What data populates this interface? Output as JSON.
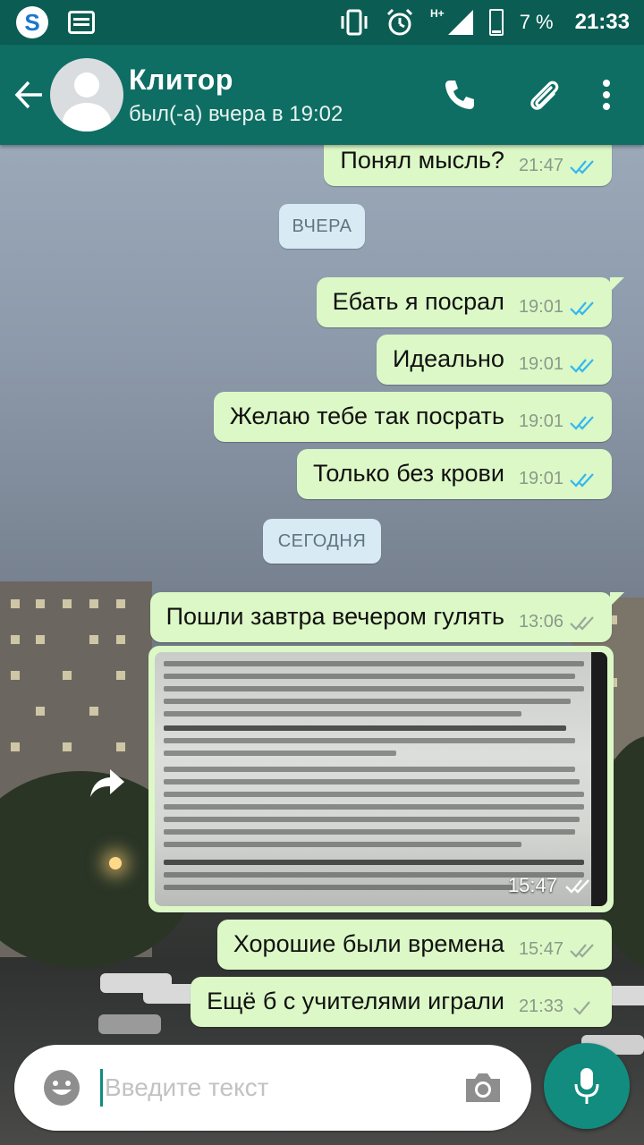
{
  "status_bar": {
    "network": "H+",
    "battery": "7 %",
    "time": "21:33"
  },
  "header": {
    "contact_name": "Клитор",
    "last_seen": "был(-а) вчера в 19:02"
  },
  "colors": {
    "header": "#0e6e63",
    "status_bar": "#0b5d53",
    "outgoing_bubble": "#dcf8c6",
    "read_ticks": "#34b7f1",
    "delivered_ticks": "#9aa99a",
    "mic_button": "#128c7e"
  },
  "chat": {
    "date_yesterday": "ВЧЕРА",
    "date_today": "СЕГОДНЯ",
    "messages": [
      {
        "text": "Понял мысль?",
        "time": "21:47",
        "status": "read"
      },
      {
        "text": "Ебать я посрал",
        "time": "19:01",
        "status": "read"
      },
      {
        "text": "Идеально",
        "time": "19:01",
        "status": "read"
      },
      {
        "text": "Желаю тебе так посрать",
        "time": "19:01",
        "status": "read"
      },
      {
        "text": "Только без крови",
        "time": "19:01",
        "status": "read"
      },
      {
        "text": "Пошли завтра вечером гулять",
        "time": "13:06",
        "status": "delivered"
      },
      {
        "text": "",
        "time": "15:47",
        "status": "delivered",
        "type": "image"
      },
      {
        "text": "Хорошие были времена",
        "time": "15:47",
        "status": "delivered"
      },
      {
        "text": "Ещё б с учителями играли",
        "time": "21:33",
        "status": "sent"
      }
    ]
  },
  "input": {
    "placeholder": "Введите текст",
    "value": ""
  },
  "icons": {
    "back": "arrow-left-icon",
    "call": "phone-icon",
    "attach": "paperclip-icon",
    "menu": "more-vert-icon",
    "emoji": "smiley-icon",
    "camera": "camera-icon",
    "mic": "microphone-icon",
    "share": "forward-icon"
  }
}
